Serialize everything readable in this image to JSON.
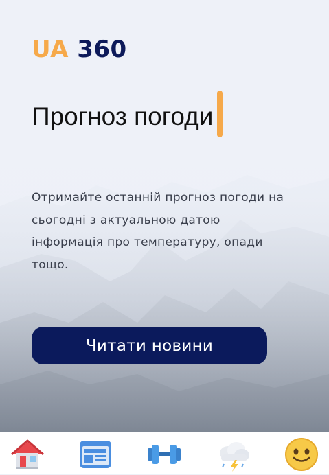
{
  "brand": {
    "part1": "UA",
    "part2": "360"
  },
  "hero": {
    "title": "Прогноз погоди",
    "description": "Отримайте останній прогноз погоди на сьогодні з актуальною датою інформація про температуру, опади тощо.",
    "button_label": "Читати новини"
  },
  "nav": {
    "items": [
      {
        "icon": "house-icon"
      },
      {
        "icon": "newspaper-layout-icon"
      },
      {
        "icon": "dumbbell-icon"
      },
      {
        "icon": "storm-cloud-icon"
      },
      {
        "icon": "smiley-face-icon"
      }
    ]
  },
  "colors": {
    "accent": "#f6a94a",
    "navy": "#0b1a5c"
  }
}
